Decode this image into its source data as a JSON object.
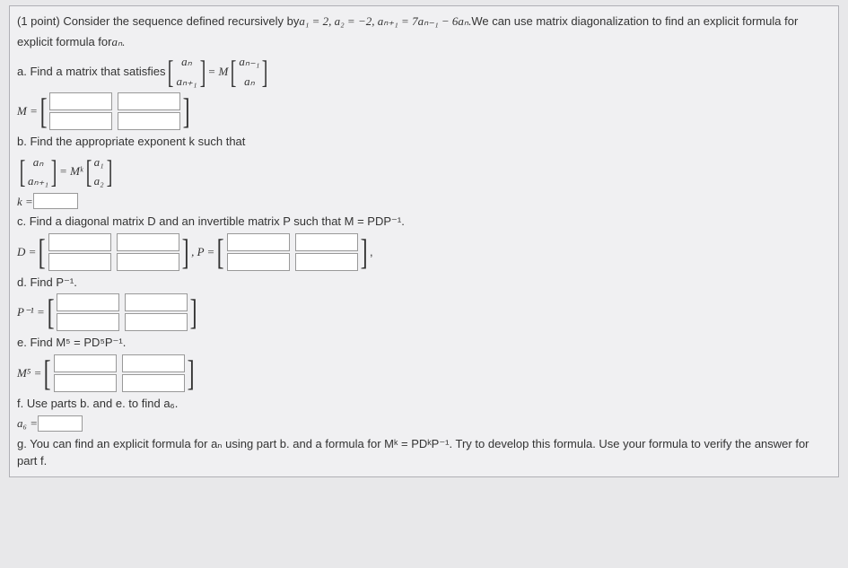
{
  "problem": {
    "points": "(1 point)",
    "intro1": "Consider the sequence defined recursively by ",
    "a1_eq": "a₁ = 2, a₂ = −2, aₙ₊₁ = 7aₙ₋₁ − 6aₙ.",
    "intro2": " We can use matrix diagonalization to find an explicit formula for ",
    "an_var": "aₙ."
  },
  "part_a": {
    "label": "a. Find a matrix that satisfies ",
    "vec_top": "aₙ",
    "vec_bot": "aₙ₊₁",
    "eq": " = M ",
    "rvec_top": "aₙ₋₁",
    "rvec_bot": "aₙ",
    "M_label": "M = "
  },
  "part_b": {
    "label": "b. Find the appropriate exponent k such that",
    "vec_top": "aₙ",
    "vec_bot": "aₙ₊₁",
    "eq": " = Mᵏ ",
    "rvec_top": "a₁",
    "rvec_bot": "a₂",
    "k_label": "k = "
  },
  "part_c": {
    "label": "c. Find a diagonal matrix D and an invertible matrix P such that M = PDP⁻¹.",
    "D_label": "D = ",
    "P_label": ", P = "
  },
  "part_d": {
    "label": "d. Find P⁻¹.",
    "Pinv_label": "P⁻¹ = "
  },
  "part_e": {
    "label": "e. Find M⁵ = PD⁵P⁻¹.",
    "M5_label": "M⁵ = "
  },
  "part_f": {
    "label": "f. Use parts b. and e. to find a₆.",
    "a6_label": "a₆ = "
  },
  "part_g": {
    "label": "g. You can find an explicit formula for aₙ using part b. and a formula for Mᵏ = PDᵏP⁻¹. Try to develop this formula. Use your formula to verify the answer for part f."
  }
}
